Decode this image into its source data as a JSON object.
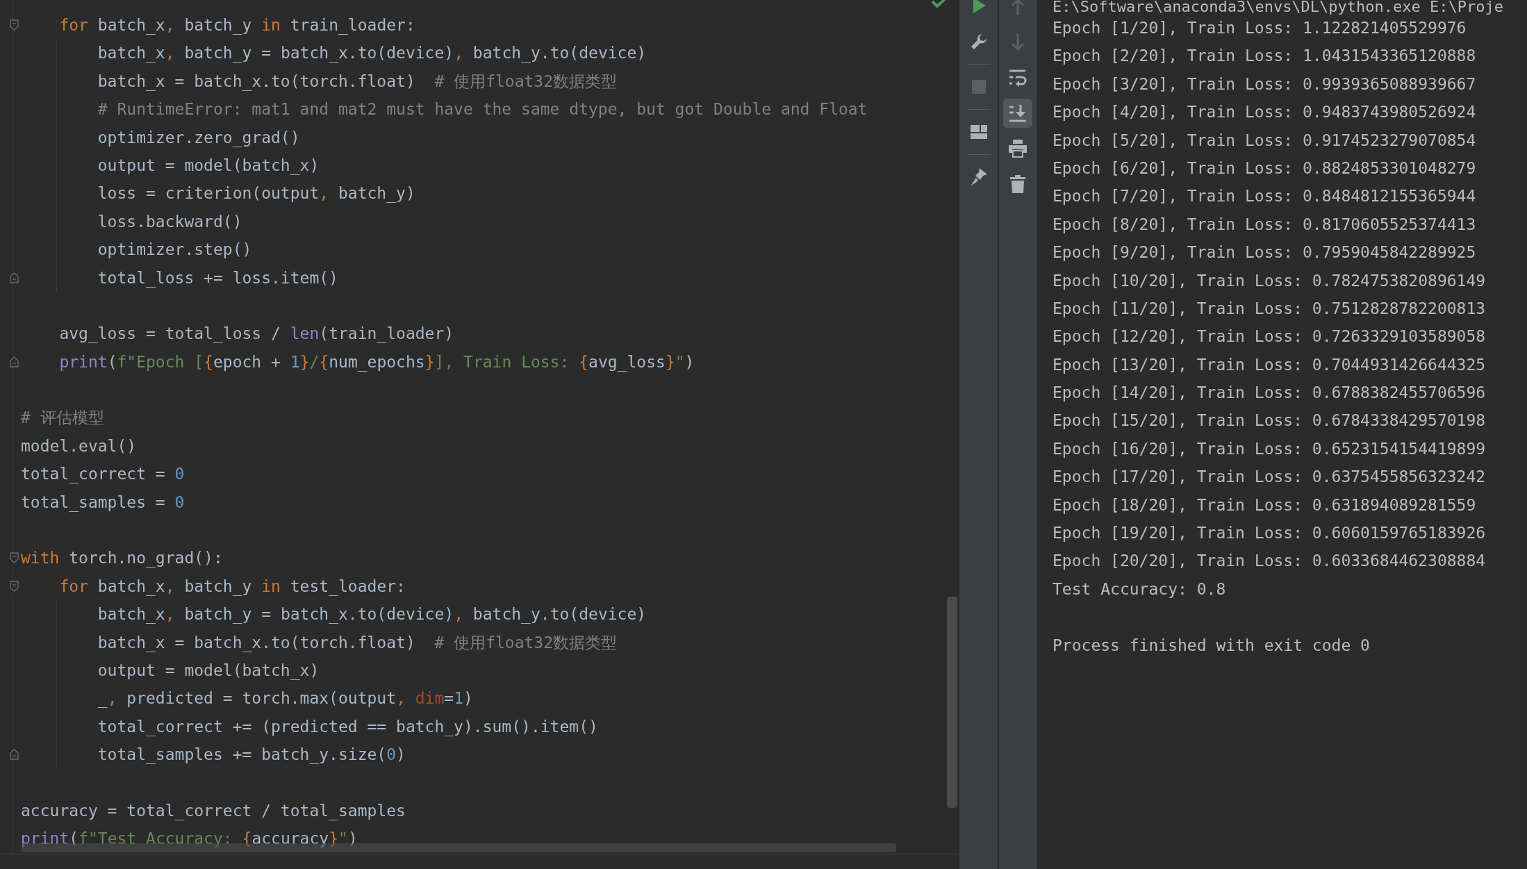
{
  "editor": {
    "lines": [
      {
        "fold_start": true,
        "tokens": [
          {
            "text": "    for",
            "kind": "keyword"
          },
          {
            "text": " batch_x",
            "kind": "plain"
          },
          {
            "text": ",",
            "kind": "punct"
          },
          {
            "text": " batch_y ",
            "kind": "plain"
          },
          {
            "text": "in",
            "kind": "keyword"
          },
          {
            "text": " train_loader:",
            "kind": "plain"
          }
        ]
      },
      {
        "tokens": [
          {
            "text": "        batch_x",
            "kind": "plain"
          },
          {
            "text": ",",
            "kind": "punct"
          },
          {
            "text": " batch_y = batch_x.to(device)",
            "kind": "plain"
          },
          {
            "text": ",",
            "kind": "punct"
          },
          {
            "text": " batch_y.to(device)",
            "kind": "plain"
          }
        ]
      },
      {
        "tokens": [
          {
            "text": "        batch_x = batch_x.to(torch.float)  ",
            "kind": "plain"
          },
          {
            "text": "# 使用float32数据类型",
            "kind": "comment"
          }
        ]
      },
      {
        "tokens": [
          {
            "text": "        # RuntimeError: mat1 and mat2 must have the same dtype, but got Double and Float",
            "kind": "comment"
          }
        ]
      },
      {
        "tokens": [
          {
            "text": "        optimizer.zero_grad()",
            "kind": "plain"
          }
        ]
      },
      {
        "tokens": [
          {
            "text": "        output = model(batch_x)",
            "kind": "plain"
          }
        ]
      },
      {
        "tokens": [
          {
            "text": "        loss = criterion(output",
            "kind": "plain"
          },
          {
            "text": ",",
            "kind": "punct"
          },
          {
            "text": " batch_y)",
            "kind": "plain"
          }
        ]
      },
      {
        "tokens": [
          {
            "text": "        loss.backward()",
            "kind": "plain"
          }
        ]
      },
      {
        "tokens": [
          {
            "text": "        optimizer.step()",
            "kind": "plain"
          }
        ]
      },
      {
        "fold_end": true,
        "tokens": [
          {
            "text": "        total_loss += loss.item()",
            "kind": "plain"
          }
        ]
      },
      {
        "blank_before": true,
        "tokens": [
          {
            "text": "    avg_loss = total_loss / ",
            "kind": "plain"
          },
          {
            "text": "len",
            "kind": "builtin"
          },
          {
            "text": "(train_loader)",
            "kind": "plain"
          }
        ]
      },
      {
        "fold_end": true,
        "tokens": [
          {
            "text": "    print",
            "kind": "builtin"
          },
          {
            "text": "(",
            "kind": "plain"
          },
          {
            "text": "f\"Epoch [",
            "kind": "string"
          },
          {
            "text": "{",
            "kind": "punct"
          },
          {
            "text": "epoch + ",
            "kind": "plain"
          },
          {
            "text": "1",
            "kind": "number"
          },
          {
            "text": "}",
            "kind": "punct"
          },
          {
            "text": "/",
            "kind": "string"
          },
          {
            "text": "{",
            "kind": "punct"
          },
          {
            "text": "num_epochs",
            "kind": "plain"
          },
          {
            "text": "}",
            "kind": "punct"
          },
          {
            "text": "], Train Loss: ",
            "kind": "string"
          },
          {
            "text": "{",
            "kind": "punct"
          },
          {
            "text": "avg_loss",
            "kind": "plain"
          },
          {
            "text": "}",
            "kind": "punct"
          },
          {
            "text": "\"",
            "kind": "string"
          },
          {
            "text": ")",
            "kind": "plain"
          }
        ]
      },
      {
        "blank_before": true,
        "tokens": [
          {
            "text": "# 评估模型",
            "kind": "comment"
          }
        ]
      },
      {
        "tokens": [
          {
            "text": "model.eval()",
            "kind": "plain"
          }
        ]
      },
      {
        "tokens": [
          {
            "text": "total_correct = ",
            "kind": "plain"
          },
          {
            "text": "0",
            "kind": "number"
          }
        ]
      },
      {
        "tokens": [
          {
            "text": "total_samples = ",
            "kind": "plain"
          },
          {
            "text": "0",
            "kind": "number"
          }
        ]
      },
      {
        "blank_before": true,
        "fold_start": true,
        "tokens": [
          {
            "text": "with",
            "kind": "keyword"
          },
          {
            "text": " torch.no_grad():",
            "kind": "plain"
          }
        ]
      },
      {
        "fold_start": true,
        "tokens": [
          {
            "text": "    for",
            "kind": "keyword"
          },
          {
            "text": " batch_x",
            "kind": "plain"
          },
          {
            "text": ",",
            "kind": "punct"
          },
          {
            "text": " batch_y ",
            "kind": "plain"
          },
          {
            "text": "in",
            "kind": "keyword"
          },
          {
            "text": " test_loader:",
            "kind": "plain"
          }
        ]
      },
      {
        "tokens": [
          {
            "text": "        batch_x",
            "kind": "plain"
          },
          {
            "text": ",",
            "kind": "punct"
          },
          {
            "text": " batch_y = batch_x.to(device)",
            "kind": "plain"
          },
          {
            "text": ",",
            "kind": "punct"
          },
          {
            "text": " batch_y.to(device)",
            "kind": "plain"
          }
        ]
      },
      {
        "tokens": [
          {
            "text": "        batch_x = batch_x.to(torch.float)  ",
            "kind": "plain"
          },
          {
            "text": "# 使用float32数据类型",
            "kind": "comment"
          }
        ]
      },
      {
        "tokens": [
          {
            "text": "        output = model(batch_x)",
            "kind": "plain"
          }
        ]
      },
      {
        "tokens": [
          {
            "text": "        _",
            "kind": "plain"
          },
          {
            "text": ", ",
            "kind": "punct"
          },
          {
            "text": "predicted = torch.max(output",
            "kind": "plain"
          },
          {
            "text": ", ",
            "kind": "punct"
          },
          {
            "text": "dim",
            "kind": "param"
          },
          {
            "text": "=",
            "kind": "plain"
          },
          {
            "text": "1",
            "kind": "number"
          },
          {
            "text": ")",
            "kind": "plain"
          }
        ]
      },
      {
        "tokens": [
          {
            "text": "        total_correct += (predicted == batch_y).sum().item()",
            "kind": "plain"
          }
        ]
      },
      {
        "fold_end": true,
        "tokens": [
          {
            "text": "        total_samples += batch_y.size(",
            "kind": "plain"
          },
          {
            "text": "0",
            "kind": "number"
          },
          {
            "text": ")",
            "kind": "plain"
          }
        ]
      },
      {
        "blank_before": true,
        "tokens": [
          {
            "text": "accuracy = total_correct / total_samples",
            "kind": "plain"
          }
        ]
      },
      {
        "tokens": [
          {
            "text": "print",
            "kind": "builtin"
          },
          {
            "text": "(",
            "kind": "plain"
          },
          {
            "text": "f\"Test Accuracy: ",
            "kind": "string"
          },
          {
            "text": "{",
            "kind": "punct"
          },
          {
            "text": "accuracy",
            "kind": "plain"
          },
          {
            "text": "}",
            "kind": "punct"
          },
          {
            "text": "\"",
            "kind": "string"
          },
          {
            "text": ")",
            "kind": "plain"
          }
        ]
      }
    ]
  },
  "run_toolbar": {
    "column_1": [
      {
        "kind": "run",
        "disabled": false
      },
      {
        "kind": "wrench",
        "disabled": false
      },
      {
        "kind": "separator"
      },
      {
        "kind": "stop",
        "disabled": true
      },
      {
        "kind": "separator"
      },
      {
        "kind": "layout",
        "disabled": false
      },
      {
        "kind": "separator"
      },
      {
        "kind": "pin",
        "disabled": false
      }
    ],
    "column_2": [
      {
        "kind": "up",
        "disabled": true,
        "selected": false
      },
      {
        "kind": "down",
        "disabled": true,
        "selected": false
      },
      {
        "kind": "wrap",
        "disabled": false,
        "selected": false
      },
      {
        "kind": "scroll_end",
        "disabled": false,
        "selected": true
      },
      {
        "kind": "print",
        "disabled": false,
        "selected": false
      },
      {
        "kind": "trash",
        "disabled": false,
        "selected": false
      }
    ]
  },
  "console": {
    "lines": [
      "E:\\Software\\anaconda3\\envs\\DL\\python.exe E:\\Proje",
      "Epoch [1/20], Train Loss: 1.122821405529976",
      "Epoch [2/20], Train Loss: 1.0431543365120888",
      "Epoch [3/20], Train Loss: 0.9939365088939667",
      "Epoch [4/20], Train Loss: 0.9483743980526924",
      "Epoch [5/20], Train Loss: 0.9174523279070854",
      "Epoch [6/20], Train Loss: 0.8824853301048279",
      "Epoch [7/20], Train Loss: 0.8484812155365944",
      "Epoch [8/20], Train Loss: 0.8170605525374413",
      "Epoch [9/20], Train Loss: 0.7959045842289925",
      "Epoch [10/20], Train Loss: 0.7824753820896149",
      "Epoch [11/20], Train Loss: 0.7512828782200813",
      "Epoch [12/20], Train Loss: 0.7263329103589058",
      "Epoch [13/20], Train Loss: 0.7044931426644325",
      "Epoch [14/20], Train Loss: 0.6788382455706596",
      "Epoch [15/20], Train Loss: 0.6784338429570198",
      "Epoch [16/20], Train Loss: 0.6523154154419899",
      "Epoch [17/20], Train Loss: 0.6375455856323242",
      "Epoch [18/20], Train Loss: 0.631894089281559",
      "Epoch [19/20], Train Loss: 0.6060159765183926",
      "Epoch [20/20], Train Loss: 0.6033684462308884",
      "Test Accuracy: 0.8"
    ],
    "exit_message": "Process finished with exit code 0"
  }
}
